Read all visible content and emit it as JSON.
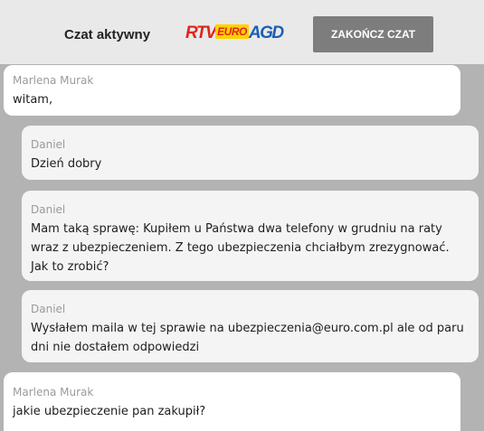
{
  "header": {
    "status": "Czat aktywny",
    "logo": {
      "part1": "RTV",
      "part2": "EURO",
      "part3": "AGD"
    },
    "end_button": "ZAKOŃCZ CZAT"
  },
  "messages": [
    {
      "author": "Marlena Murak",
      "text": "witam,"
    },
    {
      "author": "Daniel",
      "text": "Dzień dobry"
    },
    {
      "author": "Daniel",
      "text": "Mam taką sprawę: Kupiłem u Państwa dwa telefony w grudniu na raty wraz z ubezpieczeniem. Z tego ubezpieczenia chciałbym zrezygnować. Jak to zrobić?"
    },
    {
      "author": "Daniel",
      "text": "Wysłałem maila w tej sprawie na ubezpieczenia@euro.com.pl ale od paru dni nie dostałem odpowiedzi"
    },
    {
      "author": "Marlena Murak",
      "text": "jakie ubezpieczenie pan zakupił?"
    }
  ],
  "colors": {
    "background": "#b3b3b3",
    "header": "#e9e9e9",
    "button": "#7d7d7d",
    "consultant_bubble": "#ffffff",
    "customer_bubble": "#f4f4f4"
  }
}
